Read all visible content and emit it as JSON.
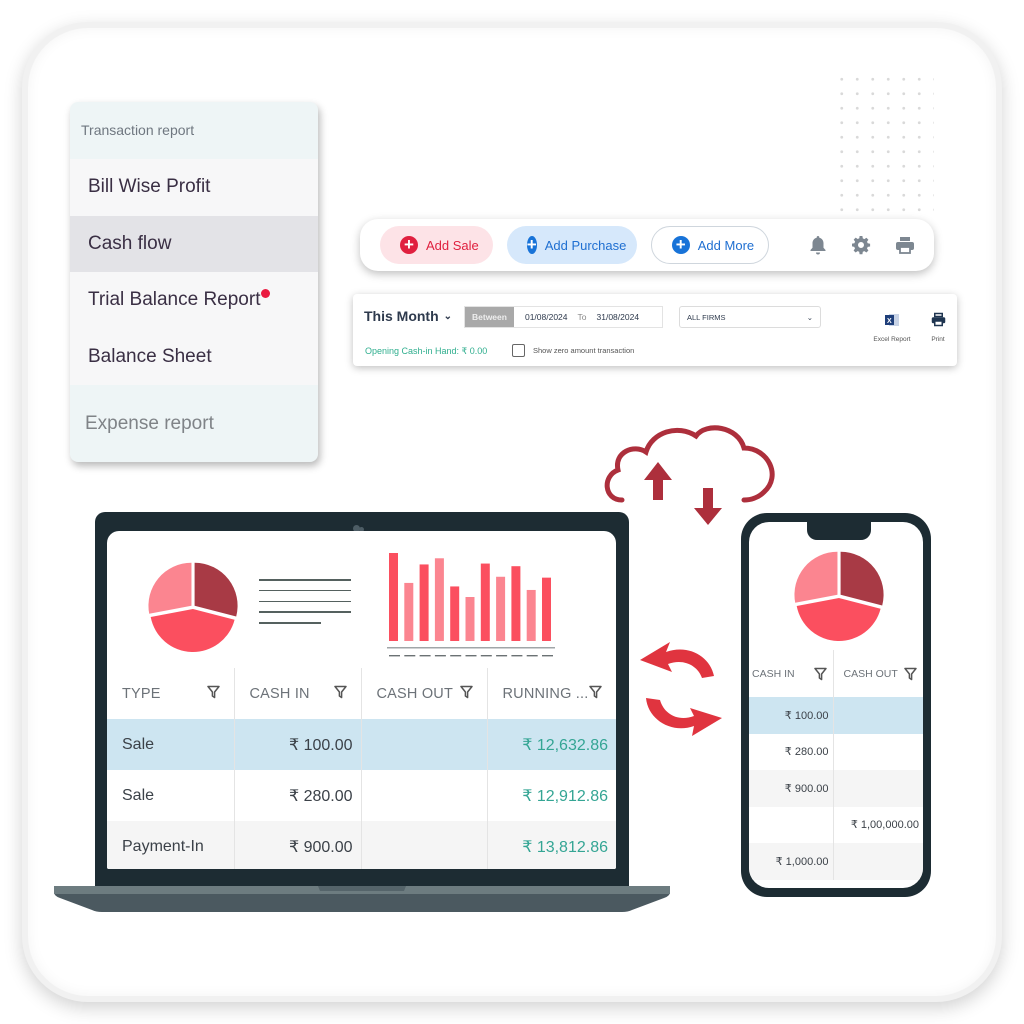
{
  "report_menu": {
    "header": "Transaction report",
    "items": [
      {
        "label": "Bill Wise Profit",
        "active": false,
        "badge": false
      },
      {
        "label": "Cash flow",
        "active": true,
        "badge": false
      },
      {
        "label": "Trial Balance Report",
        "active": false,
        "badge": true
      },
      {
        "label": "Balance Sheet",
        "active": false,
        "badge": false
      }
    ],
    "footer": "Expense report"
  },
  "toolbar": {
    "add_sale": "Add Sale",
    "add_purchase": "Add Purchase",
    "add_more": "Add More",
    "icons": [
      "bell-icon",
      "gear-icon",
      "printer-icon"
    ],
    "colors": {
      "sale": "#e0203f",
      "purchase": "#1873d8"
    }
  },
  "filters": {
    "period": "This Month",
    "range_label": "Between",
    "from_date": "01/08/2024",
    "to_label": "To",
    "to_date": "31/08/2024",
    "firm": "ALL FIRMS",
    "opening_cash": "Opening Cash-in Hand: ₹ 0.00",
    "show_zero_label": "Show zero amount transaction",
    "show_zero_checked": false,
    "excel_label": "Excel Report",
    "print_label": "Print"
  },
  "laptop": {
    "pie_slices": [
      {
        "share": 0.29,
        "color": "#a83a45"
      },
      {
        "share": 0.43,
        "color": "#fb4f5f"
      },
      {
        "share": 0.28,
        "color": "#fb8590"
      }
    ],
    "bar_values": [
      100,
      66,
      87,
      94,
      62,
      50,
      88,
      73,
      85,
      58,
      72
    ],
    "bar_colors": [
      "#fb4f5f",
      "#fb8590"
    ],
    "table": {
      "columns": [
        "TYPE",
        "CASH IN",
        "CASH OUT",
        "RUNNING ..."
      ],
      "rows": [
        {
          "type": "Sale",
          "cash_in": "₹ 100.00",
          "cash_out": "",
          "running": "₹ 12,632.86",
          "selected": true
        },
        {
          "type": "Sale",
          "cash_in": "₹ 280.00",
          "cash_out": "",
          "running": "₹ 12,912.86",
          "selected": false
        },
        {
          "type": "Payment-In",
          "cash_in": "₹ 900.00",
          "cash_out": "",
          "running": "₹ 13,812.86",
          "selected": false
        }
      ]
    }
  },
  "phone": {
    "table": {
      "columns": [
        "CASH IN",
        "CASH OUT"
      ],
      "rows": [
        {
          "cash_in": "₹ 100.00",
          "cash_out": "",
          "selected": true
        },
        {
          "cash_in": "₹ 280.00",
          "cash_out": "",
          "selected": false
        },
        {
          "cash_in": "₹ 900.00",
          "cash_out": "",
          "selected": false
        },
        {
          "cash_in": "",
          "cash_out": "₹ 1,00,000.00",
          "selected": false
        },
        {
          "cash_in": "₹ 1,000.00",
          "cash_out": "",
          "selected": false
        }
      ]
    }
  },
  "sync_color": "#e0343f",
  "cloud_color": "#ad2f3c"
}
